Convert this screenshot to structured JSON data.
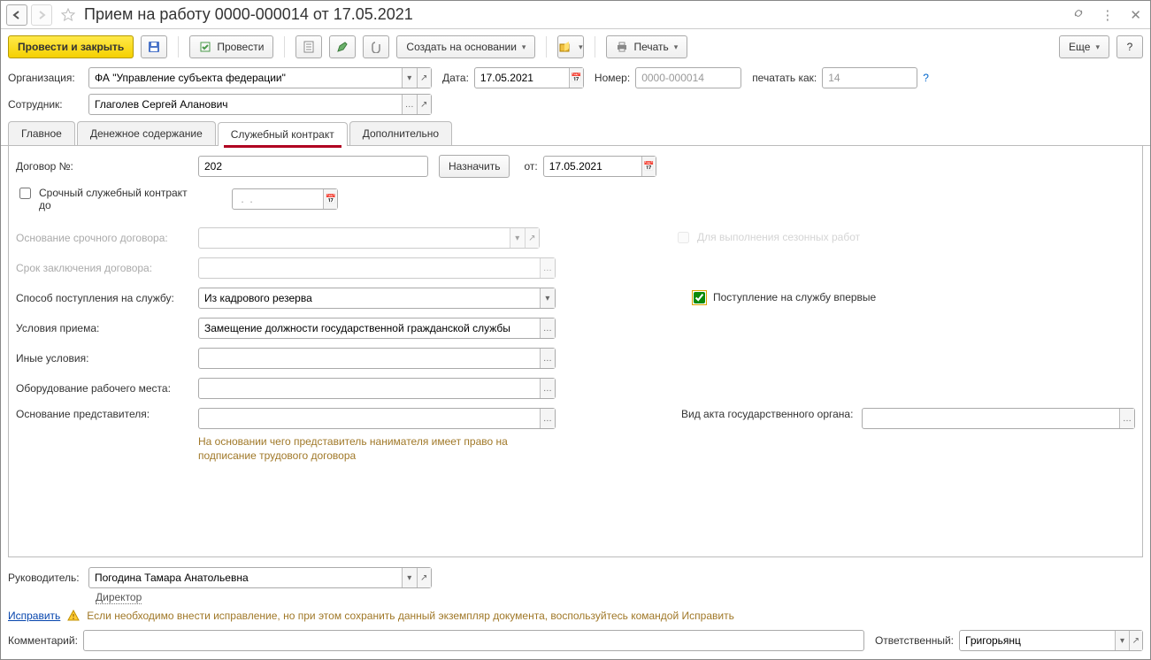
{
  "title": "Прием на работу 0000-000014 от 17.05.2021",
  "toolbar": {
    "post_close": "Провести и закрыть",
    "post": "Провести",
    "create_based": "Создать на основании",
    "print": "Печать",
    "more": "Еще",
    "help": "?"
  },
  "headerForm": {
    "org_label": "Организация:",
    "org_value": "ФА \"Управление субъекта федерации\"",
    "date_label": "Дата:",
    "date_value": "17.05.2021",
    "num_label": "Номер:",
    "num_value": "0000-000014",
    "print_as_label": "печатать как:",
    "print_as_value": "14",
    "emp_label": "Сотрудник:",
    "emp_value": "Глаголев Сергей Аланович"
  },
  "tabs": [
    "Главное",
    "Денежное содержание",
    "Служебный контракт",
    "Дополнительно"
  ],
  "contract": {
    "num_label": "Договор №:",
    "num_value": "202",
    "assign": "Назначить",
    "from_label": "от:",
    "from_value": "17.05.2021",
    "urgent_label": "Срочный служебный контракт до",
    "urgent_date": " .  .",
    "basis_urgent_label": "Основание срочного договора:",
    "term_label": "Срок заключения договора:",
    "season_label": "Для выполнения сезонных работ",
    "method_label": "Способ поступления на службу:",
    "method_value": "Из кадрового резерва",
    "first_time_label": "Поступление на службу впервые",
    "conditions_label": "Условия приема:",
    "conditions_value": "Замещение должности государственной гражданской службы",
    "other_label": "Иные условия:",
    "equipment_label": "Оборудование рабочего места:",
    "rep_basis_label": "Основание представителя:",
    "rep_basis_note": "На основании чего представитель нанимателя имеет право на подписание трудового договора",
    "act_type_label": "Вид акта государственного органа:"
  },
  "bottom": {
    "manager_label": "Руководитель:",
    "manager_value": "Погодина Тамара Анатольевна",
    "manager_pos": "Директор",
    "fix_link": "Исправить",
    "fix_note": "Если необходимо внести исправление, но при этом сохранить данный экземпляр документа, воспользуйтесь командой Исправить",
    "comment_label": "Комментарий:",
    "responsible_label": "Ответственный:",
    "responsible_value": "Григорьянц"
  }
}
